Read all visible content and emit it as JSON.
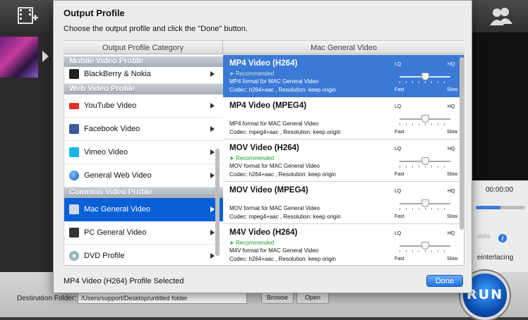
{
  "modal": {
    "title": "Output Profile",
    "subtitle": "Choose the output profile and click the \"Done\" button.",
    "left_header": "Output Profile Category",
    "right_header": "Mac General Video",
    "status": "MP4 Video (H264) Profile Selected",
    "done_label": "Done"
  },
  "categories": {
    "mobile_head": "Mobile Video Profile",
    "mobile_item": "BlackBerry & Nokia",
    "web_head": "Web Video Profile",
    "web_items": [
      "YouTube Video",
      "Facebook Video",
      "Vimeo Video",
      "General Web Video"
    ],
    "common_head": "Common Video Profile",
    "common_items": [
      "Mac General Video",
      "PC General Video",
      "DVD Profile"
    ]
  },
  "quality": {
    "lq": "LQ",
    "hq": "HQ",
    "fast": "Fast",
    "slow": "Slow"
  },
  "profiles": [
    {
      "name": "MP4 Video (H264)",
      "recommended": "Recommended",
      "desc": "MP4 format for MAC General Video",
      "codec": "Codec: h264+aac , Resolution: keep origin",
      "quality": 0.5
    },
    {
      "name": "MP4 Video (MPEG4)",
      "recommended": "",
      "desc": "MP4 format for MAC General Video",
      "codec": "Codec: mpeg4+aac , Resolution: keep origin",
      "quality": 0.5
    },
    {
      "name": "MOV Video (H264)",
      "recommended": "Recommended",
      "desc": "MOV format for MAC General Video",
      "codec": "Codec: h264+aac , Resolution: keep origin",
      "quality": 0.5
    },
    {
      "name": "MOV Video (MPEG4)",
      "recommended": "",
      "desc": "MOV format for MAC General Video",
      "codec": "Codec: mpeg4+aac , Resolution: keep origin",
      "quality": 0.5
    },
    {
      "name": "M4V Video (H264)",
      "recommended": "Recommended",
      "desc": "M4V format for MAC General Video",
      "codec": "Codec: h264+aac , Resolution: keep origin",
      "quality": 0.5
    }
  ],
  "background": {
    "time": "00:00:00",
    "nvidia": "vidia",
    "deinterlacing": "einterlacing",
    "destination_label": "Destination Folder:",
    "destination_value": "/Users/support/Desktop/untitled folder",
    "browse_label": "Browse",
    "open_label": "Open",
    "run_label": "RUN"
  },
  "colors": {
    "selection": "#0a5fd6",
    "selected_profile": "#3b79d6",
    "recommended": "#1d9e2f"
  }
}
